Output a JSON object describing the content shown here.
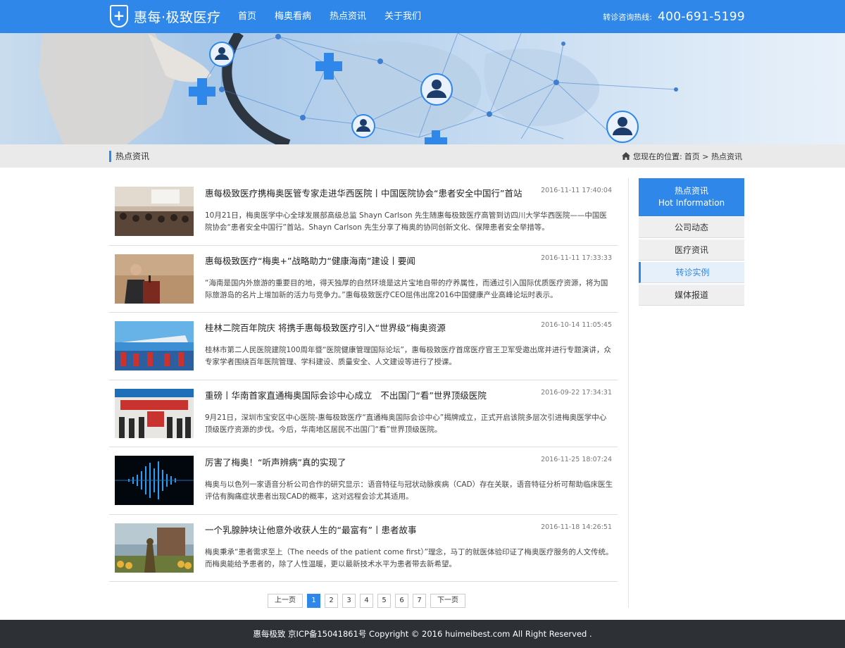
{
  "header": {
    "logo_text": "惠每·极致医疗",
    "nav": [
      "首页",
      "梅奥看病",
      "热点资讯",
      "关于我们"
    ],
    "hotline_label": "转诊咨询热线:",
    "hotline_number": "400-691-5199"
  },
  "breadcrumb": {
    "section_title": "热点资讯",
    "prefix": "您现在的位置:",
    "path": "首页 > 热点资讯"
  },
  "articles": [
    {
      "title": "惠每极致医疗携梅奥医管专家走进华西医院丨中国医院协会“患者安全中国行”首站",
      "date": "2016-11-11 17:40:04",
      "summary": "10月21日，梅奥医学中心全球发展部高级总监 Shayn Carlson 先生随惠每极致医疗高管到访四川大学华西医院——中国医院协会“患者安全中国行”首站。Shayn Carlson 先生分享了梅奥的协同创新文化、保障患者安全举措等。"
    },
    {
      "title": "惠每极致医疗“梅奥+”战略助力“健康海南”建设丨要闻",
      "date": "2016-11-11 17:33:33",
      "summary": "“海南是国内外旅游的重要目的地，得天独厚的自然环境是这片宝地自带的疗养属性，而通过引入国际优质医疗资源，将为国际旅游岛的名片上增加新的活力与竞争力。”惠每极致医疗CEO屈伟出席2016中国健康产业高峰论坛时表示。"
    },
    {
      "title": "桂林二院百年院庆 将携手惠每极致医疗引入“世界级”梅奥资源",
      "date": "2016-10-14 11:05:45",
      "summary": "桂林市第二人民医院建院100周年暨“医院健康管理国际论坛”，惠每极致医疗首席医疗官王卫军受邀出席并进行专题演讲，众专家学者围绕百年医院管理、学科建设、质量安全、人文建设等进行了授课。"
    },
    {
      "title": "重磅丨华南首家直通梅奥国际会诊中心成立   不出国门“看”世界顶级医院",
      "date": "2016-09-22 17:34:31",
      "summary": "9月21日，深圳市宝安区中心医院-惠每极致医疗“直通梅奥国际会诊中心”揭牌成立，正式开启该院多层次引进梅奥医学中心顶级医疗资源的步伐。今后，华南地区居民不出国门“看”世界顶级医院。"
    },
    {
      "title": "厉害了梅奥！“听声辨病”真的实现了",
      "date": "2016-11-25 18:07:24",
      "summary": "梅奥与以色列一家语音分析公司合作的研究显示：语音特征与冠状动脉疾病（CAD）存在关联，语音特征分析可帮助临床医生评估有胸痛症状患者出现CAD的概率，这对远程会诊尤其适用。"
    },
    {
      "title": "一个乳腺肿块让他意外收获人生的“最富有”丨患者故事",
      "date": "2016-11-18 14:26:51",
      "summary": "梅奥秉承“患者需求至上（The needs of the patient come first）”理念，马丁的就医体验印证了梅奥医疗服务的人文传统。而梅奥能给予患者的，除了人性温暖，更以最新技术水平为患者带去新希望。"
    }
  ],
  "pagination": {
    "prev": "上一页",
    "pages": [
      "1",
      "2",
      "3",
      "4",
      "5",
      "6",
      "7"
    ],
    "current": "1",
    "next": "下一页"
  },
  "sidebar": {
    "head_cn": "热点资讯",
    "head_en": "Hot Information",
    "items": [
      "公司动态",
      "医疗资讯",
      "转诊实例",
      "媒体报道"
    ],
    "active": "转诊实例"
  },
  "footer": {
    "text": "惠每极致 京ICP备15041861号 Copyright © 2016 huimeibest.com All Right Reserved ."
  },
  "colors": {
    "brand_blue": "#2f87ea",
    "footer_bg": "#2d3035",
    "crumb_bg": "#eaeaea"
  }
}
